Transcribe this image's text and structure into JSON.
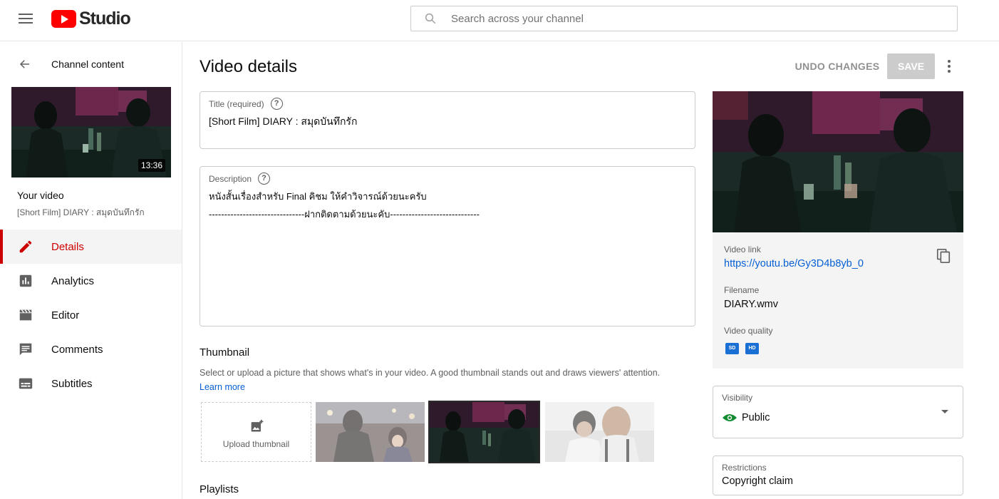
{
  "header": {
    "logo_text": "Studio",
    "search_placeholder": "Search across your channel"
  },
  "sidebar": {
    "back_label": "Channel content",
    "thumb_duration": "13:36",
    "your_video_label": "Your video",
    "video_title": "[Short Film] DIARY : สมุดบันทึกรัก",
    "items": [
      {
        "label": "Details",
        "icon": "pencil-icon",
        "active": true
      },
      {
        "label": "Analytics",
        "icon": "analytics-icon",
        "active": false
      },
      {
        "label": "Editor",
        "icon": "clapperboard-icon",
        "active": false
      },
      {
        "label": "Comments",
        "icon": "comment-icon",
        "active": false
      },
      {
        "label": "Subtitles",
        "icon": "subtitles-icon",
        "active": false
      }
    ]
  },
  "main": {
    "page_title": "Video details",
    "undo_label": "UNDO CHANGES",
    "save_label": "SAVE",
    "title_field": {
      "label": "Title (required)",
      "value": "[Short Film] DIARY : สมุดบันทึกรัก"
    },
    "description_field": {
      "label": "Description",
      "lines": [
        "หนังสั้นเรื่องสำหรับ Final คิชม ให้คำวิจารณ์ด้วยนะครับ",
        "-------------------------------ฝากติดตามด้วยนะคับ-----------------------------"
      ]
    },
    "thumbnail": {
      "heading": "Thumbnail",
      "description": "Select or upload a picture that shows what's in your video. A good thumbnail stands out and draws viewers' attention.",
      "learn_more": "Learn more",
      "upload_label": "Upload thumbnail"
    },
    "playlists_heading": "Playlists"
  },
  "right_panel": {
    "video_link_label": "Video link",
    "video_link": "https://youtu.be/Gy3D4b8yb_0",
    "filename_label": "Filename",
    "filename": "DIARY.wmv",
    "quality_label": "Video quality",
    "quality_badges": [
      "SD",
      "HD"
    ],
    "visibility_label": "Visibility",
    "visibility_value": "Public",
    "restrictions_label": "Restrictions",
    "restrictions_value": "Copyright claim"
  },
  "colors": {
    "accent_red": "#cc0000",
    "link_blue": "#065fd4",
    "public_green": "#0f8a2e"
  }
}
